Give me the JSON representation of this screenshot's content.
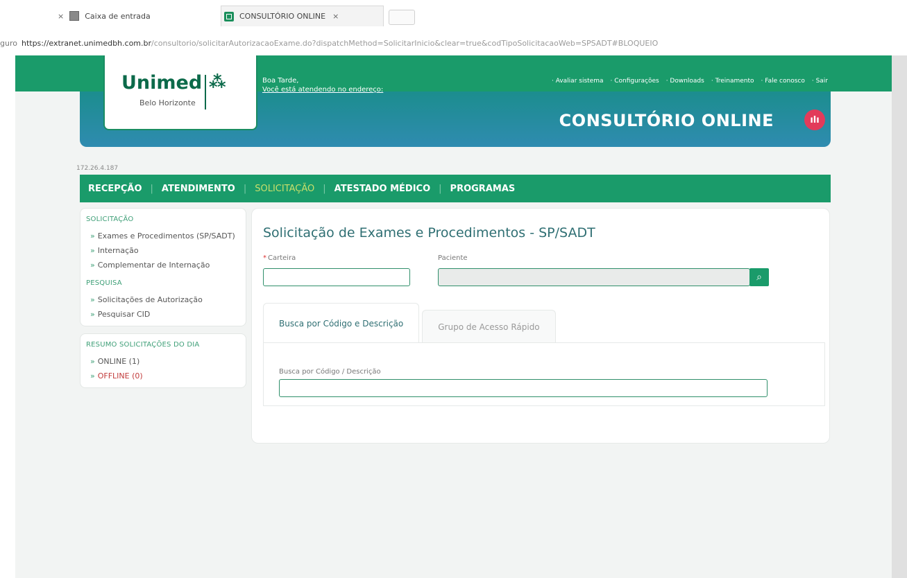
{
  "browser": {
    "tabs": [
      {
        "label": "Caixa de entrada"
      },
      {
        "label": "CONSULTÓRIO ONLINE"
      }
    ],
    "close_glyph": "×",
    "url_prefix": "guro",
    "url_host": "https://extranet.unimedbh.com.br",
    "url_rest": "/consultorio/solicitarAutorizacaoExame.do?dispatchMethod=SolicitarInicio&clear=true&codTipoSolicitacaoWeb=SPSADT#BLOQUEIO"
  },
  "header": {
    "logo_name": "Unimed",
    "logo_sub": "Belo Horizonte",
    "greeting": "Boa Tarde,",
    "greeting_sub": "Você está atendendo no endereço:",
    "top_links": [
      "· Avaliar sistema",
      "· Configurações",
      "· Downloads",
      "· Treinamento",
      "· Fale conosco",
      "· Sair"
    ],
    "app_title": "CONSULTÓRIO ONLINE"
  },
  "ip": "172.26.4.187",
  "main_nav": {
    "items": [
      "RECEPÇÃO",
      "ATENDIMENTO",
      "SOLICITAÇÃO",
      "ATESTADO MÉDICO",
      "PROGRAMAS"
    ],
    "active": "SOLICITAÇÃO"
  },
  "sidebar": {
    "solicitacao_head": "SOLICITAÇÃO",
    "solicitacao_items": [
      "Exames e Procedimentos (SP/SADT)",
      "Internação",
      "Complementar de Internação"
    ],
    "pesquisa_head": "PESQUISA",
    "pesquisa_items": [
      "Solicitações de Autorização",
      "Pesquisar CID"
    ],
    "resumo_head": "RESUMO SOLICITAÇÕES DO DIA",
    "online": "ONLINE (1)",
    "offline": "OFFLINE (0)"
  },
  "form": {
    "title": "Solicitação de Exames e Procedimentos - SP/SADT",
    "carteira_label": "Carteira",
    "paciente_label": "Paciente",
    "tab_busca": "Busca por Código e Descrição",
    "tab_grupo": "Grupo de Acesso Rápido",
    "busca_label": "Busca por Código / Descrição"
  },
  "colors": {
    "brand_green": "#1a9b6a",
    "title_teal": "#2f6f73",
    "active_nav": "#c9df6b",
    "badge_red": "#e23b5a"
  }
}
